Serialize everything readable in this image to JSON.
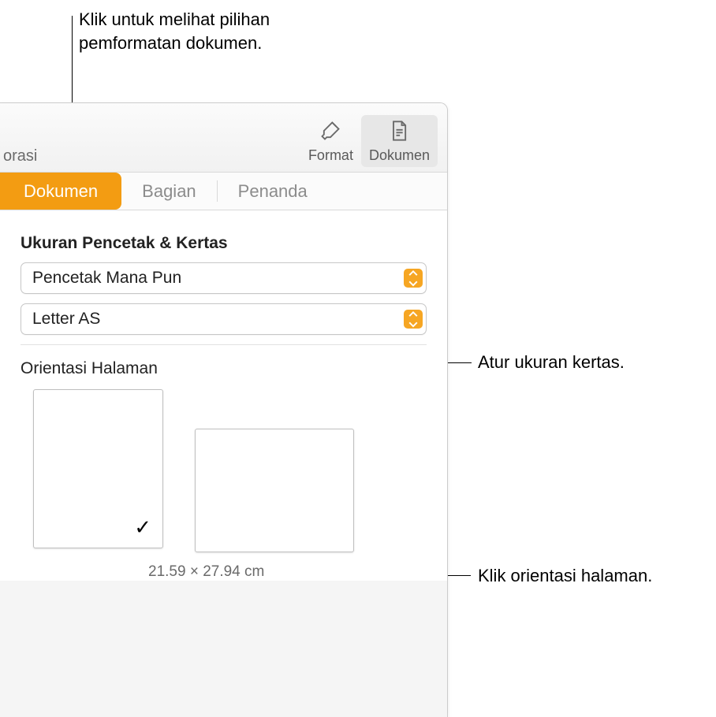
{
  "callouts": {
    "top": "Klik untuk melihat pilihan\npemformatan dokumen.",
    "paper": "Atur ukuran kertas.",
    "orient": "Klik orientasi halaman."
  },
  "toolbar": {
    "left_cut": "orasi",
    "format_label": "Format",
    "document_label": "Dokumen"
  },
  "tabs": {
    "document": "Dokumen",
    "section": "Bagian",
    "bookmarks": "Penanda"
  },
  "printer_section": {
    "title": "Ukuran Pencetak & Kertas",
    "printer_value": "Pencetak Mana Pun",
    "paper_value": "Letter AS"
  },
  "orientation": {
    "title": "Orientasi Halaman",
    "dimensions": "21.59 × 27.94 cm"
  }
}
